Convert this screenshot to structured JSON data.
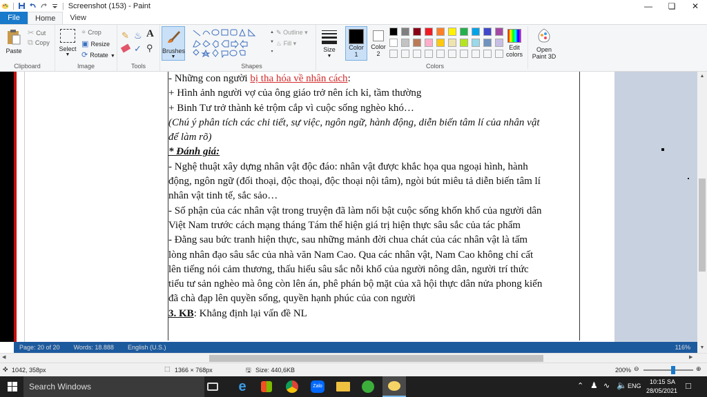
{
  "window": {
    "title": "Screenshot (153) - Paint",
    "qat_icons": [
      "paint-app-icon",
      "save-icon",
      "undo-icon",
      "redo-icon",
      "qat-dropdown-icon"
    ],
    "controls": [
      "minimize",
      "maximize",
      "close"
    ]
  },
  "tabs": [
    "File",
    "Home",
    "View"
  ],
  "ribbon": {
    "clipboard": {
      "paste": "Paste",
      "cut": "Cut",
      "copy": "Copy",
      "label": "Clipboard"
    },
    "image": {
      "select": "Select",
      "crop": "Crop",
      "resize": "Resize",
      "rotate": "Rotate",
      "label": "Image"
    },
    "tools": {
      "label": "Tools"
    },
    "brushes": {
      "label": "Brushes"
    },
    "shapes": {
      "outline": "Outline",
      "fill": "Fill",
      "label": "Shapes"
    },
    "size": {
      "label": "Size"
    },
    "color1": {
      "label1": "Color",
      "label2": "1",
      "value": "#000000"
    },
    "color2": {
      "label1": "Color",
      "label2": "2",
      "value": "#ffffff"
    },
    "palette": [
      "#000000",
      "#7f7f7f",
      "#880015",
      "#ed1c24",
      "#ff7f27",
      "#fff200",
      "#22b14c",
      "#00a2e8",
      "#3f48cc",
      "#a349a4",
      "#ffffff",
      "#c3c3c3",
      "#b97a57",
      "#ffaec9",
      "#ffc90e",
      "#efe4b0",
      "#b5e61d",
      "#99d9ea",
      "#7092be",
      "#c8bfe7"
    ],
    "colors_label": "Colors",
    "edit_colors": {
      "l1": "Edit",
      "l2": "colors"
    },
    "paint3d": {
      "l1": "Open",
      "l2": "Paint 3D"
    }
  },
  "document": {
    "lines": [
      {
        "pre": "- Những con người ",
        "red": "bị tha hóa về nhân cách",
        "post": ":"
      },
      {
        "text": "+  Hình ảnh người vợ của ông giáo trở nên ích kỉ, tầm thường"
      },
      {
        "text": "+  Binh Tư trở thành kẻ trộm cắp vì cuộc sống nghèo khó…"
      },
      {
        "italic": "(Chú ý phân tích các chi tiết, sự việc, ngôn ngữ, hành động, diễn biến tâm lí của nhân vật"
      },
      {
        "italic": "để làm rõ)"
      },
      {
        "heading": "* Đánh giá:"
      },
      {
        "text": "- Nghệ thuật xây dựng nhân vật độc đáo: nhân vật được khắc họa qua ngoại hình, hành"
      },
      {
        "text": "động, ngôn ngữ (đối thoại, độc thoại, độc thoại nội tâm), ngòi bút miêu tả diễn biến tâm lí"
      },
      {
        "text": "nhân vật tinh tế, sắc sảo…"
      },
      {
        "text": "- Số phận của các nhân vật trong truyện đã làm nổi bật cuộc sống khốn khổ của người dân"
      },
      {
        "text": "Việt Nam trước cách mạng tháng Tám thể hiện giá trị hiện thực sâu sắc của tác phẩm"
      },
      {
        "text": "- Đằng sau bức tranh hiện thực, sau những mảnh đời chua chát của các nhân vật là tấm"
      },
      {
        "text": "lòng nhân đạo sâu sắc của nhà văn Nam Cao. Qua các nhân vật, Nam Cao không chỉ cất"
      },
      {
        "text": "lên tiếng nói cảm thương, thấu hiểu sâu sắc nỗi khổ của người nông dân, người trí thức"
      },
      {
        "text": "tiểu tư sản nghèo mà ông còn lên án, phê phán bộ mặt của xã hội thực dân nửa phong kiến"
      },
      {
        "text": "đã chà đạp lên quyền sống, quyền hạnh phúc của con người"
      },
      {
        "kb": "3. KB",
        "post": ": Khẳng định lại vấn đề NL"
      }
    ]
  },
  "word_status": {
    "page": "Page: 20 of 20",
    "words": "Words: 18.888",
    "lang": "English (U.S.)",
    "zoom": "116%"
  },
  "statusbar": {
    "position": "1042, 358px",
    "selection": "1366 × 768px",
    "size": "Size: 440,6KB",
    "zoom": "200%",
    "zoom_level": 0.6
  },
  "taskbar": {
    "search": "Search Windows",
    "lang": "ENG",
    "time": "10:15 SA",
    "date": "28/05/2021"
  }
}
